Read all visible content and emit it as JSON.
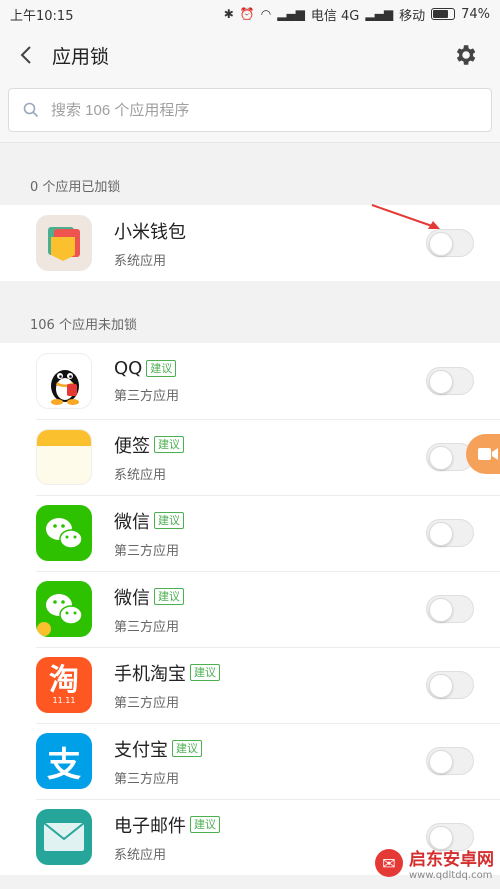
{
  "status_bar": {
    "time": "上午10:15",
    "carrier1": "电信 4G",
    "carrier2": "移动",
    "battery": "74%"
  },
  "header": {
    "title": "应用锁"
  },
  "search": {
    "placeholder": "搜索 106 个应用程序"
  },
  "locked_section": {
    "label": "0 个应用已加锁",
    "apps": [
      {
        "name": "小米钱包",
        "type": "系统应用",
        "suggest": "",
        "locked": false
      }
    ]
  },
  "unlocked_section": {
    "label": "106 个应用未加锁",
    "apps": [
      {
        "name": "QQ",
        "type": "第三方应用",
        "suggest": "建议",
        "locked": false
      },
      {
        "name": "便签",
        "type": "系统应用",
        "suggest": "建议",
        "locked": false
      },
      {
        "name": "微信",
        "type": "第三方应用",
        "suggest": "建议",
        "locked": false
      },
      {
        "name": "微信",
        "type": "第三方应用",
        "suggest": "建议",
        "locked": false
      },
      {
        "name": "手机淘宝",
        "type": "第三方应用",
        "suggest": "建议",
        "locked": false
      },
      {
        "name": "支付宝",
        "type": "第三方应用",
        "suggest": "建议",
        "locked": false
      },
      {
        "name": "电子邮件",
        "type": "系统应用",
        "suggest": "建议",
        "locked": false
      }
    ]
  },
  "icons": {
    "taobao_glyph": "淘",
    "taobao_date": "11.11",
    "alipay_glyph": "支"
  },
  "watermark": {
    "logo_glyph": "✉",
    "title": "启东安卓网",
    "url": "www.qdltdq.com"
  },
  "colors": {
    "accent_green": "#4caf50",
    "annotation_red": "#e53935"
  }
}
